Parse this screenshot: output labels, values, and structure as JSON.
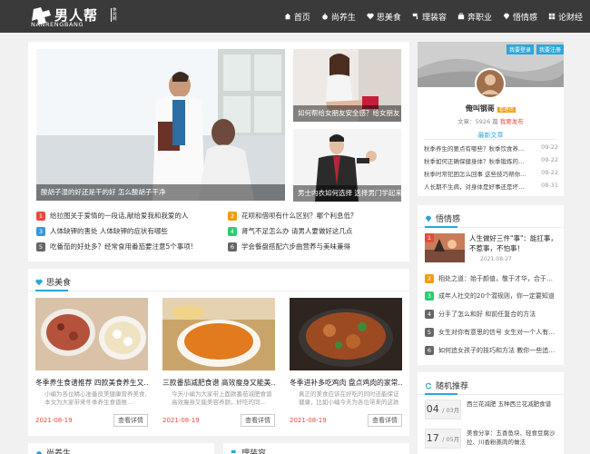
{
  "header": {
    "logo_cn": "男人帮",
    "logo_en": "NANRENGBANG",
    "logo_side": "休闲网",
    "nav": [
      {
        "icon": "home-icon",
        "label": "首页"
      },
      {
        "icon": "apple-icon",
        "label": "尚养生"
      },
      {
        "icon": "heart-icon",
        "label": "思美食"
      },
      {
        "icon": "paint-icon",
        "label": "理装容"
      },
      {
        "icon": "suitcase-icon",
        "label": "奔职业"
      },
      {
        "icon": "diamond-icon",
        "label": "悟情感"
      },
      {
        "icon": "grid-icon",
        "label": "论财经"
      }
    ]
  },
  "slides": {
    "main_caption": "酸胡子湿的好还是干的好 怎么酸胡子干净",
    "top_right_caption": "如何帮给女朋友安全感？给女朋友",
    "bottom_right_caption": "男士内衣如何选择 选择男门学起来"
  },
  "headlines": [
    {
      "n": "1",
      "text": "给拉图关于爱情的一段话,献给爱我和我爱的人"
    },
    {
      "n": "2",
      "text": "花呗和借呗有什么区别？哪个利息低？"
    },
    {
      "n": "3",
      "text": "人体缺钾的害处 人体缺钾的症状有哪些"
    },
    {
      "n": "4",
      "text": "肾气不足怎么办 请男人要做好这几点"
    },
    {
      "n": "5",
      "text": "吃番茄的好处多？经常食用番茄要注意5个事项!"
    },
    {
      "n": "6",
      "text": "学会餐盘搭配六步曲营养与美味兼得"
    }
  ],
  "food_section": {
    "title": "思美食",
    "items": [
      {
        "title": "冬季养生食谱推荐 四款美食养生又…",
        "desc": "小编为各位精心准备良美健康营养美食,本文为大家带来冬季养生食谱推…",
        "date": "2021-08-19",
        "btn": "查看详情"
      },
      {
        "title": "三款番茄减肥食谱 高效瘦身又能美…",
        "desc": "今天小编为大家带上面款番茄减肥食谱 高效瘦身又能美容养颜，好吃的同…",
        "date": "2021-08-19",
        "btn": "查看详情"
      },
      {
        "title": "冬季进补多吃鸡肉 盘点鸡肉的家常…",
        "desc": "真正的美食应该在好吃的同时还能保证健康，比如小编今天为各位带来的这款冬…",
        "date": "2021-08-19",
        "btn": "查看详情"
      }
    ]
  },
  "bottom_sections": {
    "left": "尚养生",
    "right": "理装容"
  },
  "profile": {
    "login": "我要登录",
    "register": "我要注册",
    "name": "俺叫钢哥",
    "badge": "管理员",
    "stats": "文章：5926 篇",
    "publish": "我要发布",
    "recent_title": "最新文章",
    "recent": [
      {
        "text": "秋季养生的要点有哪些？秋季饮食养…",
        "date": "09-22"
      },
      {
        "text": "秋季如何正确保健身体？秋季锻炼的…",
        "date": "09-22"
      },
      {
        "text": "秋季时常犯困怎么回事 这些技巧帮你…",
        "date": "09-22"
      },
      {
        "text": "人长期不生病，对身体是好事还是坏…",
        "date": "08-31"
      }
    ]
  },
  "emotion": {
    "title": "悟情感",
    "featured_title": "人生做好三件\"事\"：能扛事，不惹事，不怕事！",
    "featured_date": "2021-08-27",
    "items": [
      {
        "n": "2",
        "text": "相处之道：始于颜值，敬于才华，合于…"
      },
      {
        "n": "3",
        "text": "成年人社交的20个潜规则，你一定要知道"
      },
      {
        "n": "4",
        "text": "分手了怎么和好 和前任复合的方法"
      },
      {
        "n": "5",
        "text": "女生对你有意思的信号 女生对一个人有…"
      },
      {
        "n": "6",
        "text": "如何追女孩子的技巧和方法 教你一些追…"
      }
    ]
  },
  "random": {
    "title": "随机推荐",
    "items": [
      {
        "day": "04",
        "month": "/ 03月",
        "text": "西兰花减肥 五种西兰花减肥食谱"
      },
      {
        "day": "17",
        "month": "/ 05月",
        "text": "美食分享：五香鱼块、轻食豆腐沙拉、川香粉蒸肉的做法"
      }
    ]
  },
  "colors": {
    "accent": "#2ba6d8",
    "topbar": "#3a3a3a",
    "date_red": "#e74c3c"
  }
}
